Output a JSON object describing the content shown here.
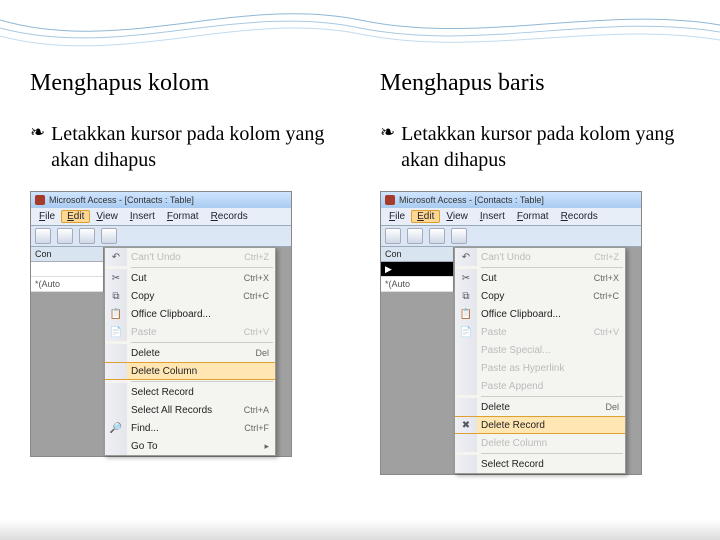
{
  "left": {
    "heading": "Menghapus kolom",
    "bullet": "Letakkan kursor pada kolom yang akan dihapus",
    "window_title": "Microsoft Access - [Contacts : Table]",
    "menus": [
      "File",
      "Edit",
      "View",
      "Insert",
      "Format",
      "Records"
    ],
    "hot_menu_index": 1,
    "grid": {
      "header": "Con",
      "row1": "",
      "row2_star": "(Auto"
    },
    "ctx": [
      {
        "kind": "item",
        "icon": "↶",
        "label": "Can't Undo",
        "shortcut": "Ctrl+Z",
        "disabled": true
      },
      {
        "kind": "sep"
      },
      {
        "kind": "item",
        "icon": "✂",
        "label": "Cut",
        "shortcut": "Ctrl+X"
      },
      {
        "kind": "item",
        "icon": "⧉",
        "label": "Copy",
        "shortcut": "Ctrl+C"
      },
      {
        "kind": "item",
        "icon": "📋",
        "label": "Office Clipboard..."
      },
      {
        "kind": "item",
        "icon": "📄",
        "label": "Paste",
        "shortcut": "Ctrl+V",
        "disabled": true
      },
      {
        "kind": "sep"
      },
      {
        "kind": "item",
        "icon": "",
        "label": "Delete",
        "shortcut": "Del"
      },
      {
        "kind": "item",
        "icon": "",
        "label": "Delete Column",
        "highlight": true
      },
      {
        "kind": "sep"
      },
      {
        "kind": "item",
        "icon": "",
        "label": "Select Record"
      },
      {
        "kind": "item",
        "icon": "",
        "label": "Select All Records",
        "shortcut": "Ctrl+A"
      },
      {
        "kind": "item",
        "icon": "🔎",
        "label": "Find...",
        "shortcut": "Ctrl+F"
      },
      {
        "kind": "item",
        "icon": "",
        "label": "Go To",
        "submenu": true
      }
    ]
  },
  "right": {
    "heading": "Menghapus baris",
    "bullet": "Letakkan kursor pada kolom yang akan dihapus",
    "window_title": "Microsoft Access - [Contacts : Table]",
    "menus": [
      "File",
      "Edit",
      "View",
      "Insert",
      "Format",
      "Records"
    ],
    "hot_menu_index": 1,
    "grid": {
      "header": "Con",
      "row1_sel": " ",
      "row2_star": "(Auto"
    },
    "ctx": [
      {
        "kind": "item",
        "icon": "↶",
        "label": "Can't Undo",
        "shortcut": "Ctrl+Z",
        "disabled": true
      },
      {
        "kind": "sep"
      },
      {
        "kind": "item",
        "icon": "✂",
        "label": "Cut",
        "shortcut": "Ctrl+X"
      },
      {
        "kind": "item",
        "icon": "⧉",
        "label": "Copy",
        "shortcut": "Ctrl+C"
      },
      {
        "kind": "item",
        "icon": "📋",
        "label": "Office Clipboard..."
      },
      {
        "kind": "item",
        "icon": "📄",
        "label": "Paste",
        "shortcut": "Ctrl+V",
        "disabled": true
      },
      {
        "kind": "item",
        "icon": "",
        "label": "Paste Special...",
        "disabled": true
      },
      {
        "kind": "item",
        "icon": "",
        "label": "Paste as Hyperlink",
        "disabled": true
      },
      {
        "kind": "item",
        "icon": "",
        "label": "Paste Append",
        "disabled": true
      },
      {
        "kind": "sep"
      },
      {
        "kind": "item",
        "icon": "",
        "label": "Delete",
        "shortcut": "Del"
      },
      {
        "kind": "item",
        "icon": "✖",
        "label": "Delete Record",
        "highlight": true
      },
      {
        "kind": "item",
        "icon": "",
        "label": "Delete Column",
        "disabled": true
      },
      {
        "kind": "sep"
      },
      {
        "kind": "item",
        "icon": "",
        "label": "Select Record"
      }
    ]
  }
}
